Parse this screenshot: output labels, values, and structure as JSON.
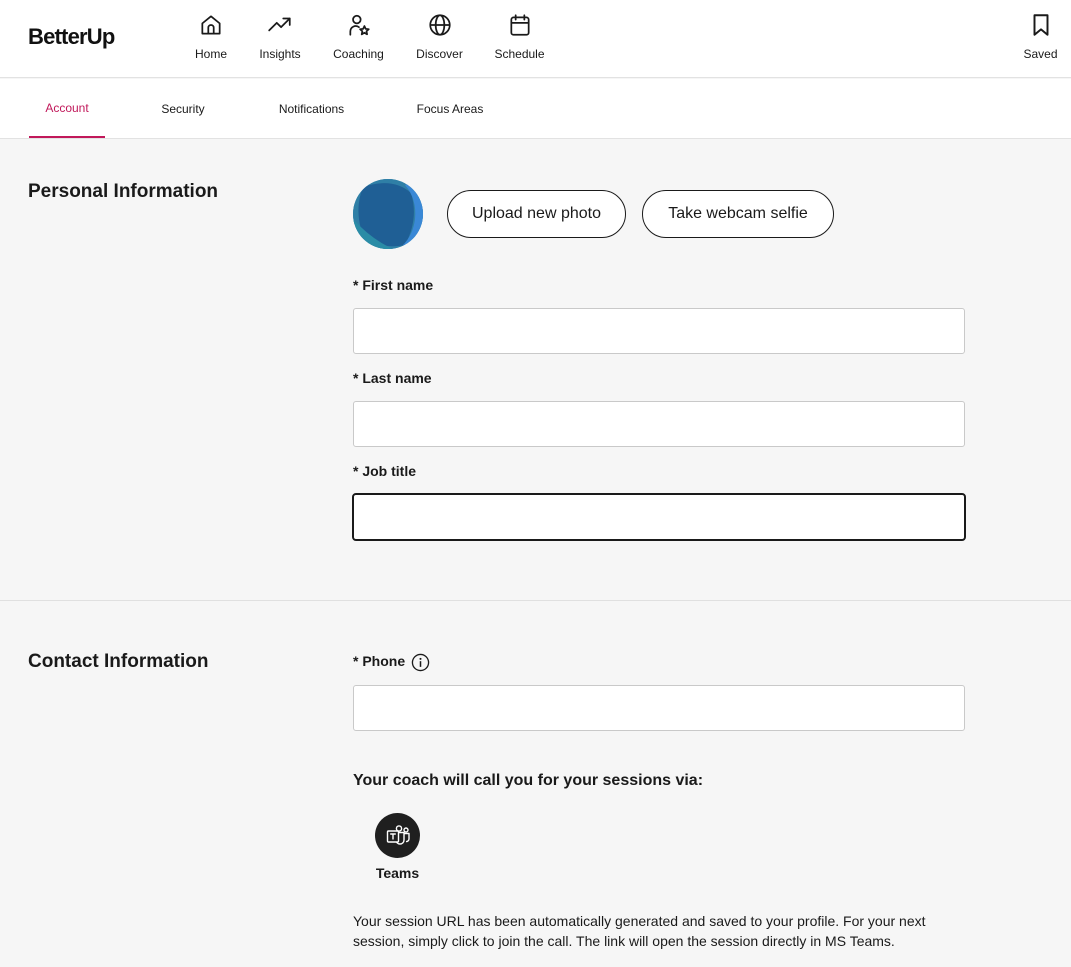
{
  "brand": {
    "logo_text": "BetterUp",
    "accent_color": "#c1185a"
  },
  "nav": {
    "items": [
      {
        "label": "Home",
        "icon": "home-icon"
      },
      {
        "label": "Insights",
        "icon": "trending-up-icon"
      },
      {
        "label": "Coaching",
        "icon": "coach-icon"
      },
      {
        "label": "Discover",
        "icon": "globe-icon"
      },
      {
        "label": "Schedule",
        "icon": "calendar-icon"
      }
    ],
    "saved": {
      "label": "Saved",
      "icon": "bookmark-icon"
    }
  },
  "tabs": [
    {
      "label": "Account",
      "active": true
    },
    {
      "label": "Security",
      "active": false
    },
    {
      "label": "Notifications",
      "active": false
    },
    {
      "label": "Focus Areas",
      "active": false
    }
  ],
  "personal": {
    "title": "Personal Information",
    "upload_label": "Upload new photo",
    "webcam_label": "Take webcam selfie",
    "fields": {
      "first_name": {
        "label": "* First name",
        "value": ""
      },
      "last_name": {
        "label": "* Last name",
        "value": ""
      },
      "job_title": {
        "label": "* Job title",
        "value": "",
        "focused": true
      }
    }
  },
  "contact": {
    "title": "Contact Information",
    "phone": {
      "label": "* Phone",
      "value": "",
      "info_icon": "info-icon"
    },
    "call_heading": "Your coach will call you for your sessions via:",
    "provider": {
      "label": "Teams",
      "icon": "ms-teams-icon"
    },
    "session_note": "Your session URL has been automatically generated and saved to your profile. For your next session, simply click to join the call. The link will open the session directly in MS Teams."
  }
}
